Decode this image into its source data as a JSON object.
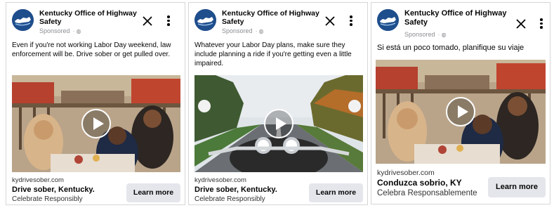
{
  "ads": [
    {
      "page_name": "Kentucky Office of Highway Safety",
      "sponsored": "Sponsored",
      "caption": "Even if you're not working Labor Day weekend, law enforcement will be. Drive sober or get pulled over.",
      "domain": "kydrivesober.com",
      "headline": "Drive sober, Kentucky.",
      "subtext": "Celebrate Responsibly",
      "cta": "Learn more",
      "media_icon": "play-icon"
    },
    {
      "page_name": "Kentucky Office of Highway Safety",
      "sponsored": "Sponsored",
      "caption": "Whatever your Labor Day plans, make sure they include planning a ride if you're getting even a little impaired.",
      "domain": "kydrivesober.com",
      "headline": "Drive sober, Kentucky.",
      "subtext": "Celebrate Responsibly",
      "cta": "Learn more",
      "media_icon": "play-icon"
    },
    {
      "page_name": "Kentucky Office of Highway Safety",
      "sponsored": "Sponsored",
      "caption": "Si está un poco tomado, planifique su viaje",
      "domain": "kydrivesober.com",
      "headline": "Conduzca sobrio, KY",
      "subtext": "Celebra Responsablemente",
      "cta": "Learn more",
      "media_icon": "play-icon"
    }
  ],
  "icons": {
    "close": "close-icon",
    "more": "more-options-icon",
    "globe": "globe-icon",
    "logo": "kentucky-state-logo"
  },
  "colors": {
    "logo_blue": "#1f4e8c",
    "button_bg": "#e4e6eb",
    "muted_text": "#8a8d91"
  }
}
